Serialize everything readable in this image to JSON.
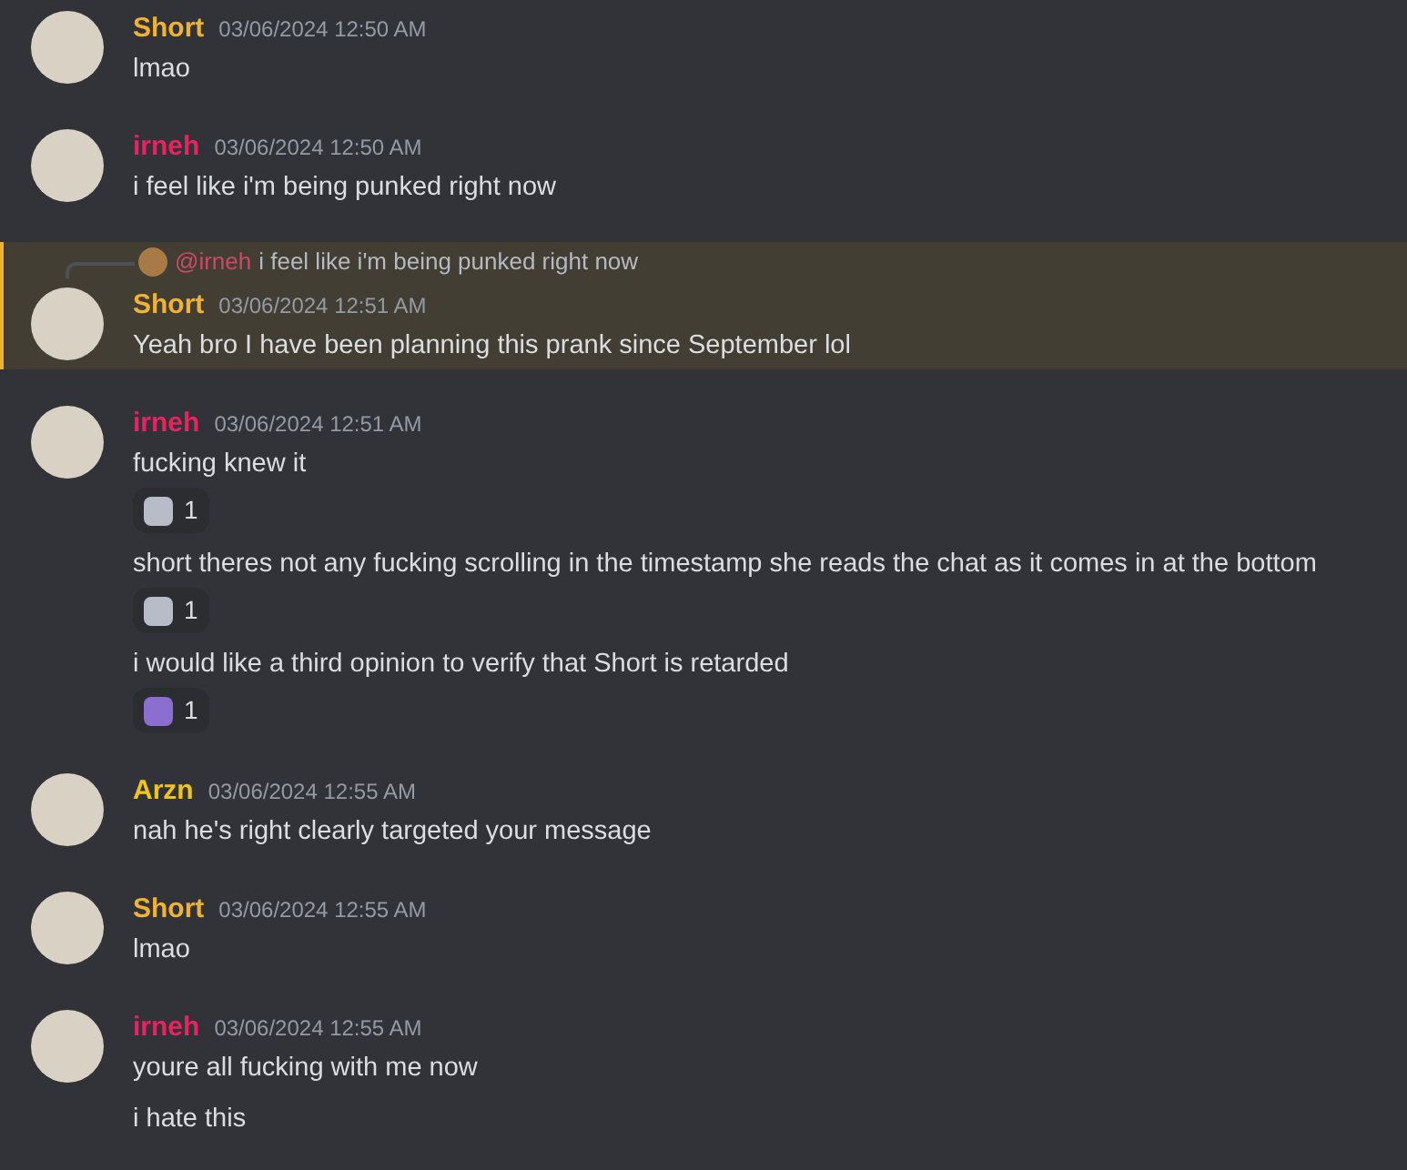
{
  "messages": [
    {
      "author": "Short",
      "color": "#f0b232",
      "timestamp": "03/06/2024 12:50 AM",
      "highlighted": false,
      "lines": [
        {
          "text": "lmao"
        }
      ]
    },
    {
      "author": "irneh",
      "color": "#e7245f",
      "timestamp": "03/06/2024 12:50 AM",
      "highlighted": false,
      "lines": [
        {
          "text": "i feel like i'm being punked right now"
        }
      ]
    },
    {
      "author": "Short",
      "color": "#f0b232",
      "timestamp": "03/06/2024 12:51 AM",
      "highlighted": true,
      "reply": {
        "mention": "@irneh",
        "color": "#c94a6a",
        "text": "i feel like i'm being punked right now"
      },
      "lines": [
        {
          "text": "Yeah bro I have been planning this prank since September lol"
        }
      ]
    },
    {
      "author": "irneh",
      "color": "#e7245f",
      "timestamp": "03/06/2024 12:51 AM",
      "highlighted": false,
      "lines": [
        {
          "text": "fucking knew it",
          "reactions": [
            {
              "count": "1"
            }
          ]
        },
        {
          "text": "short theres not any fucking scrolling in the timestamp she reads the chat as it comes in at the bottom",
          "reactions": [
            {
              "count": "1"
            }
          ]
        },
        {
          "text": "i would like a third opinion to verify that Short is retarded",
          "reactions": [
            {
              "count": "1"
            }
          ]
        }
      ]
    },
    {
      "author": "Arzn",
      "color": "#f0c419",
      "timestamp": "03/06/2024 12:55 AM",
      "highlighted": false,
      "lines": [
        {
          "text": "nah he's right clearly targeted your message"
        }
      ]
    },
    {
      "author": "Short",
      "color": "#f0b232",
      "timestamp": "03/06/2024 12:55 AM",
      "highlighted": false,
      "lines": [
        {
          "text": "lmao"
        }
      ]
    },
    {
      "author": "irneh",
      "color": "#e7245f",
      "timestamp": "03/06/2024 12:55 AM",
      "highlighted": false,
      "lines": [
        {
          "text": "youre all fucking with me now"
        },
        {
          "text": "i hate this"
        }
      ]
    }
  ]
}
